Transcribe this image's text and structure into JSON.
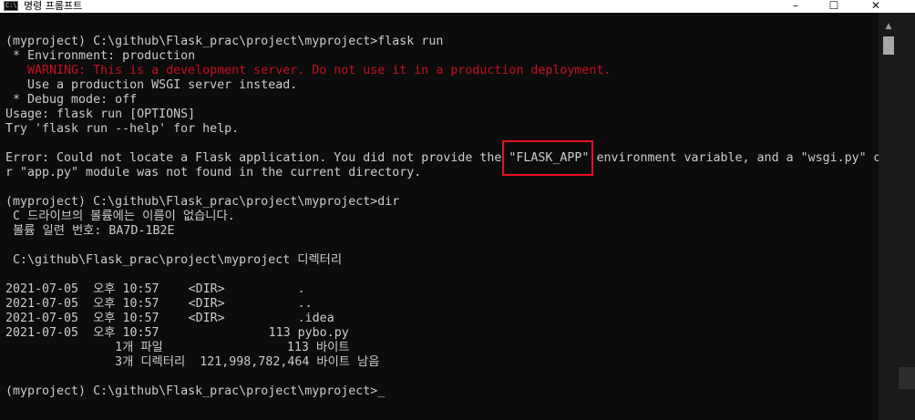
{
  "window": {
    "title": "명령 프롬프트",
    "icon": "cmd-icon",
    "controls": {
      "minimize": "–",
      "maximize": "☐",
      "close": "✕"
    }
  },
  "console": {
    "lines": [
      "(myproject) C:\\github\\Flask_prac\\project\\myproject>flask run",
      " * Environment: production",
      "   WARNING: This is a development server. Do not use it in a production deployment.",
      "   Use a production WSGI server instead.",
      " * Debug mode: off",
      "Usage: flask run [OPTIONS]",
      "Try 'flask run --help' for help.",
      "",
      "Error: Could not locate a Flask application. You did not provide the \"FLASK_APP\" environment variable, and a \"wsgi.py\" o",
      "r \"app.py\" module was not found in the current directory.",
      "",
      "(myproject) C:\\github\\Flask_prac\\project\\myproject>dir",
      " C 드라이브의 볼륨에는 이름이 없습니다.",
      " 볼륨 일련 번호: BA7D-1B2E",
      "",
      " C:\\github\\Flask_prac\\project\\myproject 디렉터리",
      "",
      "2021-07-05  오후 10:57    <DIR>          .",
      "2021-07-05  오후 10:57    <DIR>          ..",
      "2021-07-05  오후 10:57    <DIR>          .idea",
      "2021-07-05  오후 10:57               113 pybo.py",
      "               1개 파일                 113 바이트",
      "               3개 디렉터리  121,998,782,464 바이트 남음",
      "",
      "(myproject) C:\\github\\Flask_prac\\project\\myproject>_"
    ],
    "colors": {
      "text": "#cccccc",
      "warning": "#c50f1f",
      "highlight_box": "#e81123"
    }
  }
}
